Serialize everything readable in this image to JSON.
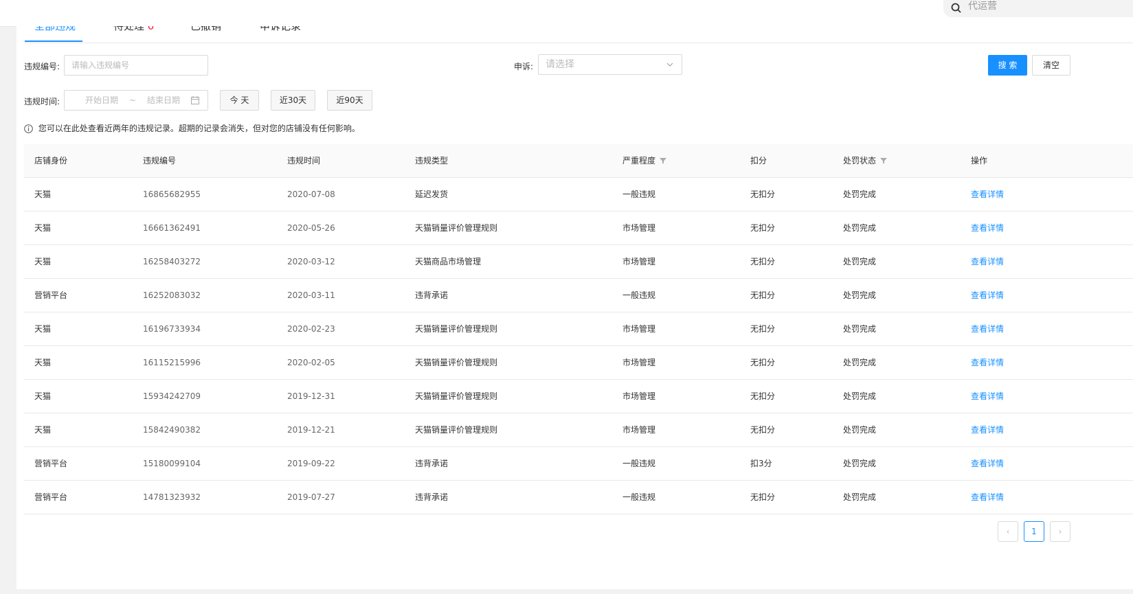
{
  "topbar": {
    "search_placeholder": "代运营"
  },
  "tabs": [
    {
      "label": "全部违规"
    },
    {
      "label": "待处理",
      "count": "0"
    },
    {
      "label": "已撤销"
    },
    {
      "label": "申诉记录"
    }
  ],
  "filters": {
    "violation_no_label": "违规编号:",
    "violation_no_placeholder": "请输入违规编号",
    "appeal_label": "申诉:",
    "appeal_placeholder": "请选择",
    "search_button": "搜 索",
    "clear_button": "清空",
    "time_label": "违规时间:",
    "start_placeholder": "开始日期",
    "range_sep": "~",
    "end_placeholder": "结束日期",
    "today_button": "今 天",
    "last30_button": "近30天",
    "last90_button": "近90天"
  },
  "notice": "您可以在此处查看近两年的违规记录。超期的记录会消失，但对您的店铺没有任何影响。",
  "table": {
    "headers": [
      "店铺身份",
      "违规编号",
      "违规时间",
      "违规类型",
      "严重程度",
      "扣分",
      "处罚状态",
      "操作"
    ],
    "rows": [
      [
        "天猫",
        "16865682955",
        "2020-07-08",
        "延迟发货",
        "一般违规",
        "无扣分",
        "处罚完成",
        "查看详情"
      ],
      [
        "天猫",
        "16661362491",
        "2020-05-26",
        "天猫销量评价管理规则",
        "市场管理",
        "无扣分",
        "处罚完成",
        "查看详情"
      ],
      [
        "天猫",
        "16258403272",
        "2020-03-12",
        "天猫商品市场管理",
        "市场管理",
        "无扣分",
        "处罚完成",
        "查看详情"
      ],
      [
        "营销平台",
        "16252083032",
        "2020-03-11",
        "违背承诺",
        "一般违规",
        "无扣分",
        "处罚完成",
        "查看详情"
      ],
      [
        "天猫",
        "16196733934",
        "2020-02-23",
        "天猫销量评价管理规则",
        "市场管理",
        "无扣分",
        "处罚完成",
        "查看详情"
      ],
      [
        "天猫",
        "16115215996",
        "2020-02-05",
        "天猫销量评价管理规则",
        "市场管理",
        "无扣分",
        "处罚完成",
        "查看详情"
      ],
      [
        "天猫",
        "15934242709",
        "2019-12-31",
        "天猫销量评价管理规则",
        "市场管理",
        "无扣分",
        "处罚完成",
        "查看详情"
      ],
      [
        "天猫",
        "15842490382",
        "2019-12-21",
        "天猫销量评价管理规则",
        "市场管理",
        "无扣分",
        "处罚完成",
        "查看详情"
      ],
      [
        "营销平台",
        "15180099104",
        "2019-09-22",
        "违背承诺",
        "一般违规",
        "扣3分",
        "处罚完成",
        "查看详情"
      ],
      [
        "营销平台",
        "14781323932",
        "2019-07-27",
        "违背承诺",
        "一般违规",
        "无扣分",
        "处罚完成",
        "查看详情"
      ]
    ]
  },
  "pagination": {
    "prev": "‹",
    "current": "1",
    "next": "›"
  },
  "colors": {
    "accent": "#1890ff",
    "danger": "#f5222d"
  }
}
